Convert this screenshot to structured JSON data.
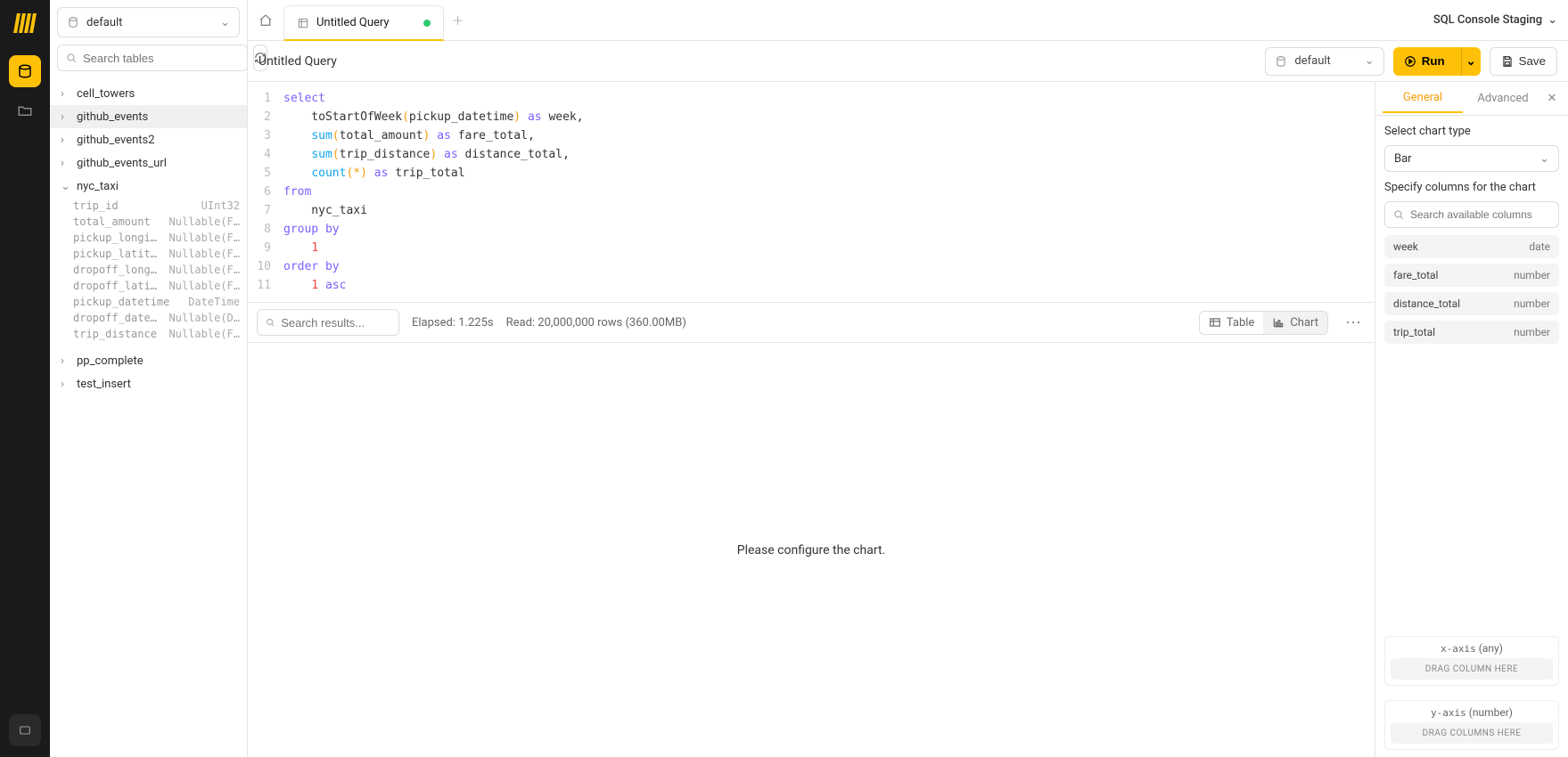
{
  "header": {
    "console_label": "SQL Console Staging"
  },
  "sidebar": {
    "db_selected": "default",
    "search_placeholder": "Search tables",
    "tables": [
      {
        "name": "cell_towers",
        "open": false
      },
      {
        "name": "github_events",
        "open": false,
        "selected": true
      },
      {
        "name": "github_events2",
        "open": false
      },
      {
        "name": "github_events_url",
        "open": false
      },
      {
        "name": "nyc_taxi",
        "open": true,
        "columns": [
          {
            "name": "trip_id",
            "type": "UInt32"
          },
          {
            "name": "total_amount",
            "type": "Nullable(F…"
          },
          {
            "name": "pickup_longi…",
            "type": "Nullable(F…"
          },
          {
            "name": "pickup_latit…",
            "type": "Nullable(F…"
          },
          {
            "name": "dropoff_long…",
            "type": "Nullable(F…"
          },
          {
            "name": "dropoff_lati…",
            "type": "Nullable(F…"
          },
          {
            "name": "pickup_datetime",
            "type": "DateTime"
          },
          {
            "name": "dropoff_date…",
            "type": "Nullable(D…"
          },
          {
            "name": "trip_distance",
            "type": "Nullable(F…"
          }
        ]
      },
      {
        "name": "pp_complete",
        "open": false
      },
      {
        "name": "test_insert",
        "open": false
      }
    ]
  },
  "tabs": {
    "active": {
      "label": "Untitled Query",
      "dirty": true
    }
  },
  "toolbar": {
    "title": "Untitled Query",
    "db": "default",
    "run_label": "Run",
    "save_label": "Save"
  },
  "editor": {
    "lines": [
      [
        {
          "t": "select",
          "c": "kw"
        }
      ],
      [
        {
          "t": "    toStartOfWeek",
          "c": "id"
        },
        {
          "t": "(",
          "c": "p"
        },
        {
          "t": "pickup_datetime",
          "c": "id"
        },
        {
          "t": ")",
          "c": "p"
        },
        {
          "t": " as ",
          "c": "kw"
        },
        {
          "t": "week",
          "c": "id"
        },
        {
          "t": ",",
          "c": "id"
        }
      ],
      [
        {
          "t": "    ",
          "c": "id"
        },
        {
          "t": "sum",
          "c": "fn"
        },
        {
          "t": "(",
          "c": "p"
        },
        {
          "t": "total_amount",
          "c": "id"
        },
        {
          "t": ")",
          "c": "p"
        },
        {
          "t": " as ",
          "c": "kw"
        },
        {
          "t": "fare_total",
          "c": "id"
        },
        {
          "t": ",",
          "c": "id"
        }
      ],
      [
        {
          "t": "    ",
          "c": "id"
        },
        {
          "t": "sum",
          "c": "fn"
        },
        {
          "t": "(",
          "c": "p"
        },
        {
          "t": "trip_distance",
          "c": "id"
        },
        {
          "t": ")",
          "c": "p"
        },
        {
          "t": " as ",
          "c": "kw"
        },
        {
          "t": "distance_total",
          "c": "id"
        },
        {
          "t": ",",
          "c": "id"
        }
      ],
      [
        {
          "t": "    ",
          "c": "id"
        },
        {
          "t": "count",
          "c": "fn"
        },
        {
          "t": "(",
          "c": "p"
        },
        {
          "t": "*",
          "c": "p"
        },
        {
          "t": ")",
          "c": "p"
        },
        {
          "t": " as ",
          "c": "kw"
        },
        {
          "t": "trip_total",
          "c": "id"
        }
      ],
      [
        {
          "t": "from",
          "c": "kw"
        }
      ],
      [
        {
          "t": "    nyc_taxi",
          "c": "id"
        }
      ],
      [
        {
          "t": "group by",
          "c": "kw"
        }
      ],
      [
        {
          "t": "    ",
          "c": "id"
        },
        {
          "t": "1",
          "c": "num"
        }
      ],
      [
        {
          "t": "order by",
          "c": "kw"
        }
      ],
      [
        {
          "t": "    ",
          "c": "id"
        },
        {
          "t": "1",
          "c": "num"
        },
        {
          "t": " asc",
          "c": "kw"
        }
      ]
    ]
  },
  "results": {
    "search_placeholder": "Search results...",
    "elapsed": "Elapsed: 1.225s",
    "read": "Read: 20,000,000 rows (360.00MB)",
    "view_table": "Table",
    "view_chart": "Chart",
    "empty_msg": "Please configure the chart."
  },
  "rpanel": {
    "tab_general": "General",
    "tab_advanced": "Advanced",
    "lbl_type": "Select chart type",
    "chart_type": "Bar",
    "lbl_cols": "Specify columns for the chart",
    "search_placeholder": "Search available columns",
    "columns": [
      {
        "name": "week",
        "type": "date"
      },
      {
        "name": "fare_total",
        "type": "number"
      },
      {
        "name": "distance_total",
        "type": "number"
      },
      {
        "name": "trip_total",
        "type": "number"
      }
    ],
    "xaxis_label": "x-axis",
    "xaxis_hint": "(any)",
    "xaxis_drop": "DRAG COLUMN HERE",
    "yaxis_label": "y-axis",
    "yaxis_hint": "(number)",
    "yaxis_drop": "DRAG COLUMNS HERE"
  }
}
